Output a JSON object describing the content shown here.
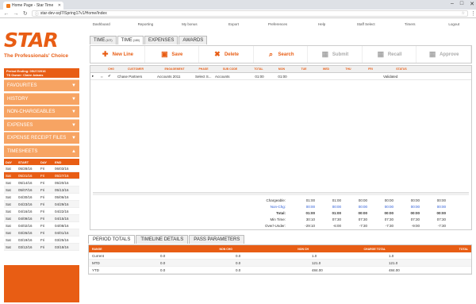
{
  "browser": {
    "tab_title": "Home Page - Star Time",
    "url": "star-dev-sql7/Spring17v1/Home/Index",
    "window_controls": [
      "–",
      "□",
      "✕"
    ]
  },
  "topnav": [
    "Dashboard",
    "Reporting",
    "My bonus",
    "Export",
    "Preferences",
    "Help",
    "Staff Select",
    "Timers",
    "Logout"
  ],
  "logo": {
    "brand": "STAR",
    "tagline": "The Professionals' Choice"
  },
  "period": {
    "line1": "Period Ending: 05/27/2016",
    "line2": "TS Owner: Claire Adams"
  },
  "sidebar": [
    {
      "label": "FAVOURITES",
      "arrow": "▼"
    },
    {
      "label": "HISTORY",
      "arrow": "▼"
    },
    {
      "label": "NON-CHARGEABLES",
      "arrow": "▼"
    },
    {
      "label": "EXPENSES",
      "arrow": "▼"
    },
    {
      "label": "EXPENSE RECEIPT FILES",
      "arrow": "▼"
    },
    {
      "label": "TIMESHEETS",
      "arrow": "▲"
    }
  ],
  "timesheets": {
    "headers": [
      "DAY",
      "START",
      "DAY",
      "END"
    ],
    "rows": [
      [
        "Sat",
        "05/28/16",
        "Fri",
        "06/03/16"
      ],
      [
        "Sat",
        "05/21/16",
        "Fri",
        "05/27/16"
      ],
      [
        "Sat",
        "05/14/16",
        "Fri",
        "05/20/16"
      ],
      [
        "Sat",
        "05/07/16",
        "Fri",
        "05/13/16"
      ],
      [
        "Sat",
        "04/30/16",
        "Fri",
        "05/06/16"
      ],
      [
        "Sat",
        "04/23/16",
        "Fri",
        "04/29/16"
      ],
      [
        "Sat",
        "04/16/16",
        "Fri",
        "04/22/16"
      ],
      [
        "Sat",
        "04/09/16",
        "Fri",
        "04/15/16"
      ],
      [
        "Sat",
        "04/02/16",
        "Fri",
        "04/08/16"
      ],
      [
        "Sat",
        "03/26/16",
        "Fri",
        "04/01/16"
      ],
      [
        "Sat",
        "03/19/16",
        "Fri",
        "03/25/16"
      ],
      [
        "Sat",
        "03/12/16",
        "Fri",
        "03/18/16"
      ]
    ],
    "selected_index": 1
  },
  "maintabs": [
    {
      "label": "TIME",
      "sub": "(107)"
    },
    {
      "label": "TIME",
      "sub": "(180)"
    },
    {
      "label": "EXPENSES",
      "sub": ""
    },
    {
      "label": "AWARDS",
      "sub": ""
    }
  ],
  "toolbar": [
    {
      "label": "New Line",
      "icon": "plus-icon",
      "glyph": "✚",
      "enabled": true
    },
    {
      "label": "Save",
      "icon": "save-icon",
      "glyph": "▣",
      "enabled": true
    },
    {
      "label": "Delete",
      "icon": "delete-icon",
      "glyph": "✖",
      "enabled": true
    },
    {
      "label": "Search",
      "icon": "search-icon",
      "glyph": "⌕",
      "enabled": true
    },
    {
      "label": "Submit",
      "icon": "submit-icon",
      "glyph": "▦",
      "enabled": false
    },
    {
      "label": "Recall",
      "icon": "recall-icon",
      "glyph": "▦",
      "enabled": false
    },
    {
      "label": "Approve",
      "icon": "approve-icon",
      "glyph": "▦",
      "enabled": false
    }
  ],
  "grid": {
    "headers": [
      "",
      "",
      "CHG",
      "CUSTOMER",
      "ENGAGEMENT",
      "PHASE",
      "SUB CODE",
      "TOTAL",
      "MON",
      "TUE",
      "WED",
      "THU",
      "FRI",
      "STATUS"
    ],
    "row": [
      "▸",
      "⇔",
      "✔",
      "Chase Partners",
      "Accounts 2011",
      "Select S...",
      "Accounts",
      "01:00",
      "01:00",
      "",
      "",
      "",
      "",
      "Validated"
    ]
  },
  "totals": [
    {
      "label": "Chargeable:",
      "values": [
        "01:00",
        "01:00",
        "00:00",
        "00:00",
        "00:00",
        "00:00"
      ],
      "style": ""
    },
    {
      "label": "Non-Chg:",
      "values": [
        "00:00",
        "00:00",
        "00:00",
        "00:00",
        "00:00",
        "00:00"
      ],
      "style": "blue"
    },
    {
      "label": "Total:",
      "values": [
        "01:00",
        "01:00",
        "00:00",
        "00:00",
        "00:00",
        "00:00"
      ],
      "style": "b"
    },
    {
      "label": "Min Time:",
      "values": [
        "30:10",
        "07:30",
        "07:30",
        "07:30",
        "07:30",
        "07:30"
      ],
      "style": ""
    },
    {
      "label": "Over/-Under:",
      "values": [
        "-29:10",
        "-6:00",
        "-7:30",
        "-7:30",
        "-9:00",
        "-7:30"
      ],
      "style": ""
    }
  ],
  "bottomtabs": [
    "PERIOD TOTALS",
    "TIMELINE DETAILS",
    "PASS PARAMETERS"
  ],
  "period_totals": {
    "headers": [
      "",
      "RANGE",
      "NON CHG",
      "NON CH",
      "CHARGE TOTAL",
      "TOTAL"
    ],
    "rows": [
      [
        "Current",
        "0.0",
        "0.0",
        "1.0",
        "1.0"
      ],
      [
        "MTD",
        "0.0",
        "0.0",
        "121.0",
        "121.0"
      ],
      [
        "YTD",
        "0.0",
        "0.0",
        "484.00",
        "484.00"
      ]
    ]
  },
  "colors": {
    "accent": "#e85d14",
    "sidebar": "#f7a463",
    "link_blue": "#2a5bd7"
  }
}
